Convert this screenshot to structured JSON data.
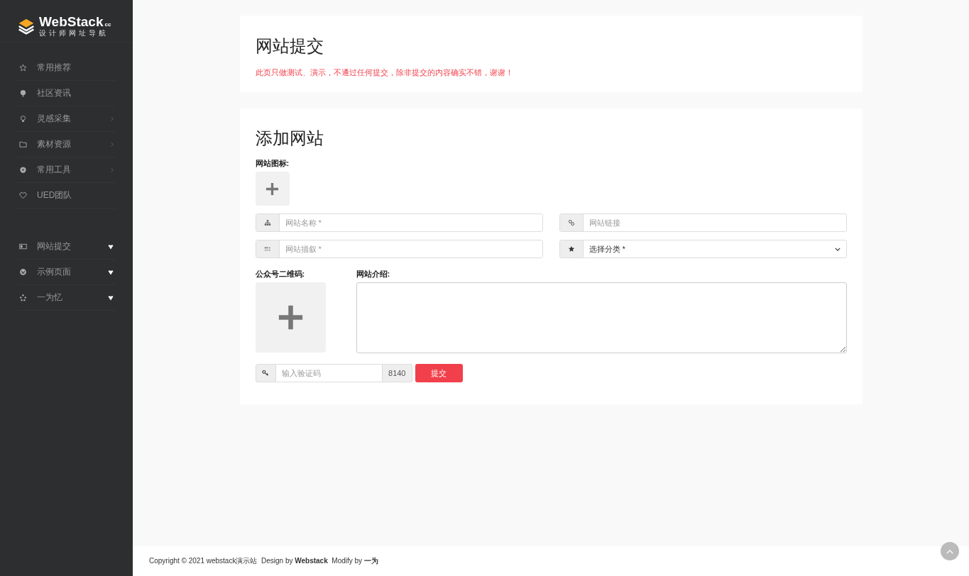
{
  "sidebar": {
    "logo": {
      "name": "WebStack",
      "suffix": "cc",
      "tagline": "设计师网址导航"
    },
    "menu_groups": [
      {
        "items": [
          {
            "label": "常用推荐",
            "kind": "link"
          },
          {
            "label": "社区资讯",
            "kind": "link"
          },
          {
            "label": "灵感采集",
            "kind": "submenu"
          },
          {
            "label": "素材资源",
            "kind": "submenu"
          },
          {
            "label": "常用工具",
            "kind": "submenu"
          },
          {
            "label": "UED团队",
            "kind": "link"
          }
        ]
      },
      {
        "items": [
          {
            "label": "网站提交",
            "kind": "dropdown"
          },
          {
            "label": "示例页面",
            "kind": "dropdown"
          },
          {
            "label": "一为忆",
            "kind": "dropdown"
          }
        ]
      }
    ]
  },
  "notice_card": {
    "title": "网站提交",
    "notice": "此页只做测试、演示，不通过任何提交，除非提交的内容确实不错，谢谢！"
  },
  "form_card": {
    "title": "添加网站",
    "icon_label": "网站图标:",
    "fields": [
      {
        "kind": "text",
        "placeholder": "网站名称 *"
      },
      {
        "kind": "text",
        "placeholder": "网站链接"
      },
      {
        "kind": "text",
        "placeholder": "网站描叙 *"
      },
      {
        "kind": "select",
        "value": "选择分类 *"
      }
    ],
    "qr_label": "公众号二维码:",
    "intro_label": "网站介绍:",
    "captcha": {
      "placeholder": "输入验证码",
      "code": "8140"
    },
    "submit": "提交"
  },
  "footer": "Copyright © 2021 webstack演示站  Design by **Webstack**  Modify by **一为**"
}
